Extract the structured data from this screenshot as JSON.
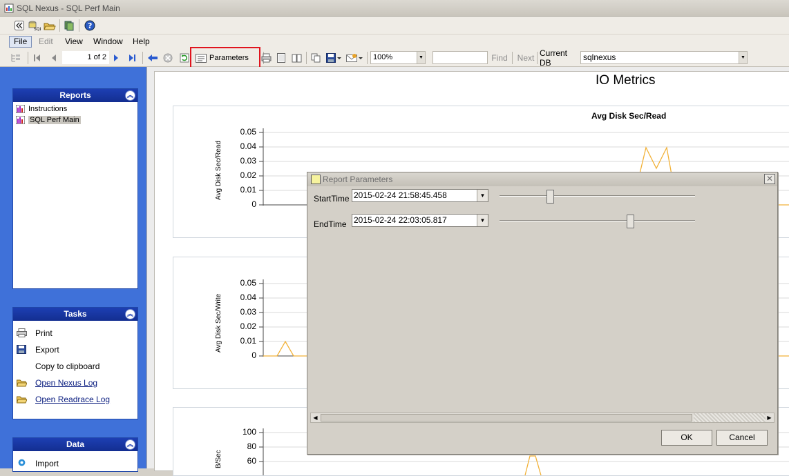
{
  "window": {
    "title": "SQL Nexus - SQL Perf Main"
  },
  "menu": [
    "File",
    "Edit",
    "View",
    "Window",
    "Help"
  ],
  "report_toolbar": {
    "page_indicator": "1 of 2",
    "parameters_label": "Parameters",
    "zoom": "100%",
    "find_label": "Find",
    "next_label": "Next",
    "current_db_label": "Current DB",
    "current_db_value": "sqlnexus"
  },
  "left_panel": {
    "reports": {
      "title": "Reports",
      "items": [
        "Instructions",
        "SQL Perf Main"
      ],
      "selected": "SQL Perf Main"
    },
    "tasks": {
      "title": "Tasks",
      "items": [
        "Print",
        "Export",
        "Copy to clipboard",
        "Open Nexus Log",
        "Open Readrace Log"
      ]
    },
    "data": {
      "title": "Data",
      "items": [
        "Import"
      ]
    }
  },
  "report": {
    "title": "IO Metrics",
    "charts": [
      {
        "title": "Avg Disk Sec/Read",
        "ylabel": "Avg Disk Sec/Read",
        "ticks": [
          "0.05",
          "0.04",
          "0.03",
          "0.02",
          "0.01",
          "0"
        ]
      },
      {
        "title": "",
        "ylabel": "Avg Disk Sec/Write",
        "ticks": [
          "0.05",
          "0.04",
          "0.03",
          "0.02",
          "0.01",
          "0"
        ]
      },
      {
        "title": "",
        "ylabel": "B/Sec",
        "ticks": [
          "100",
          "80",
          "60"
        ]
      }
    ]
  },
  "dialog": {
    "title": "Report Parameters",
    "start_label": "StartTime",
    "start_value": "2015-02-24 21:58:45.458",
    "start_slider_position": 0.26,
    "end_label": "EndTime",
    "end_value": "2015-02-24 22:03:05.817",
    "end_slider_position": 0.67,
    "ok_label": "OK",
    "cancel_label": "Cancel"
  },
  "colors": {
    "panel_blue": "#3f71d9",
    "panel_header": "#1d3fb3",
    "highlight_red": "#e0141e",
    "series_orange": "#f2b137"
  }
}
